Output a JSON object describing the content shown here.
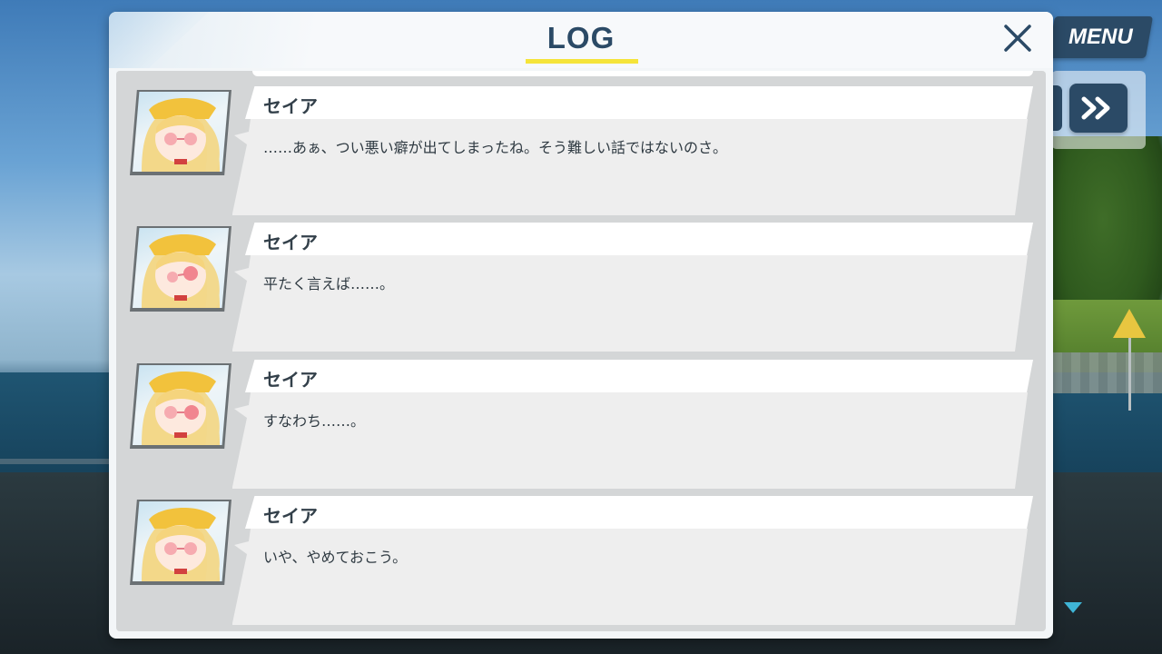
{
  "hud": {
    "menu_label": "MENU"
  },
  "log": {
    "title": "LOG",
    "entries": [
      {
        "speaker": "セイア",
        "message": "……あぁ、つい悪い癖が出てしまったね。そう難しい話ではないのさ。"
      },
      {
        "speaker": "セイア",
        "message": "平たく言えば……。"
      },
      {
        "speaker": "セイア",
        "message": "すなわち……。"
      },
      {
        "speaker": "セイア",
        "message": "いや、やめておこう。"
      }
    ]
  },
  "colors": {
    "accent_navy": "#2b4a66",
    "title_underline": "#f5e43a",
    "scroll_arrow": "#3fb5d6"
  },
  "icons": {
    "close": "close-icon",
    "fast_forward": "fast-forward-icon",
    "scroll_down": "scroll-down-icon"
  }
}
